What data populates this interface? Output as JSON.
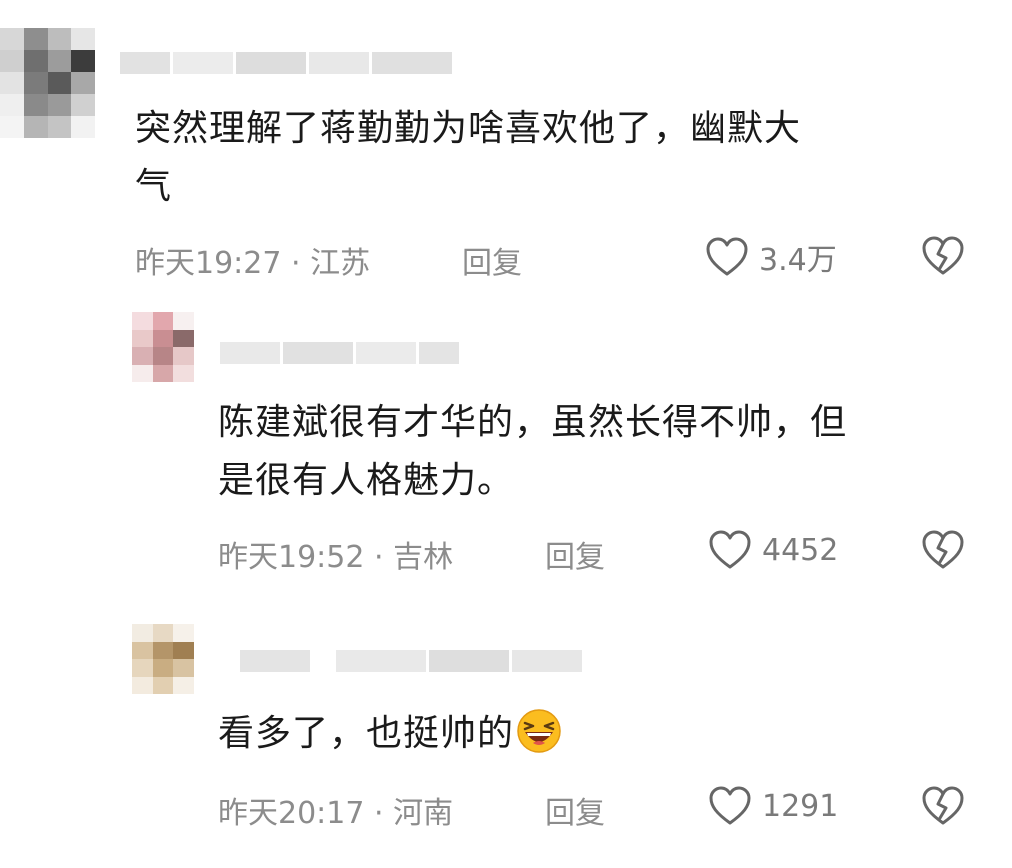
{
  "comments": [
    {
      "text_lines": [
        "突然理解了蒋勤勤为啥喜欢他了，幽默大",
        "气"
      ],
      "time": "昨天19:27 · 江苏",
      "reply_label": "回复",
      "likes": "3.4万"
    },
    {
      "text_lines": [
        "陈建斌很有才华的，虽然长得不帅，但",
        "是很有人格魅力。"
      ],
      "time": "昨天19:52 · 吉林",
      "reply_label": "回复",
      "likes": "4452"
    },
    {
      "text_lines": [
        "看多了，也挺帅的"
      ],
      "emoji": "laughing-emoji",
      "time": "昨天20:17 · 河南",
      "reply_label": "回复",
      "likes": "1291"
    }
  ],
  "icons": {
    "like": "heart-outline-icon",
    "dislike": "broken-heart-icon"
  },
  "colors": {
    "text": "#1a1a1a",
    "meta": "#8c8c8c",
    "icon": "#666666"
  }
}
